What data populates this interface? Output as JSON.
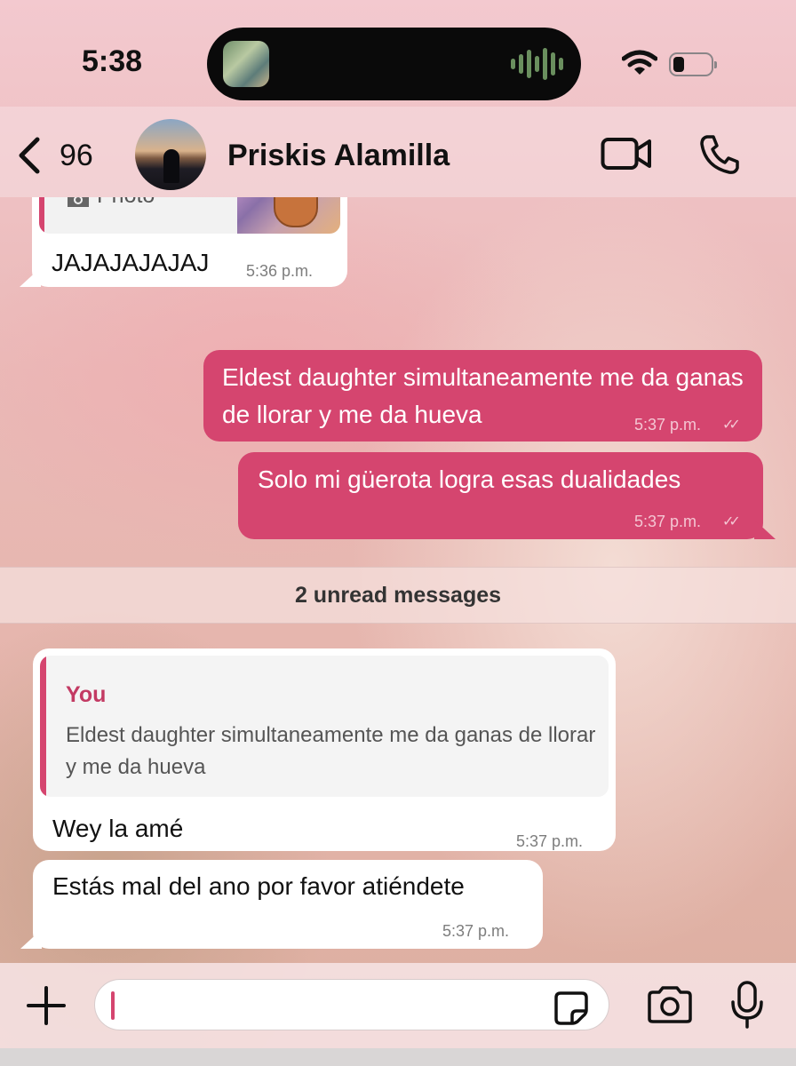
{
  "status_bar": {
    "time": "5:38"
  },
  "header": {
    "back_count": "96",
    "contact_name": "Priskis Alamilla"
  },
  "messages": [
    {
      "direction": "incoming",
      "reply_to": {
        "label": "Photo"
      },
      "text": "JAJAJAJAJAJ",
      "time": "5:36 p.m."
    },
    {
      "direction": "outgoing",
      "text": "Eldest daughter simultaneamente me da ganas de llorar y me da hueva",
      "time": "5:37 p.m."
    },
    {
      "direction": "outgoing",
      "text": "Solo mi güerota logra esas dualidades",
      "time": "5:37 p.m."
    },
    {
      "direction": "incoming",
      "reply_to": {
        "author": "You",
        "text": "Eldest daughter simultaneamente me da ganas de llorar y me da hueva"
      },
      "text": "Wey la amé",
      "time": "5:37 p.m."
    },
    {
      "direction": "incoming",
      "text": "Estás mal del ano por favor atiéndete",
      "time": "5:37 p.m."
    }
  ],
  "unread_divider": "2 unread messages",
  "composer": {
    "value": ""
  },
  "icons": {
    "back": "chevron-left-icon",
    "video": "video-camera-icon",
    "phone": "phone-icon",
    "plus": "plus-icon",
    "sticker": "sticker-icon",
    "camera": "camera-icon",
    "mic": "microphone-icon"
  },
  "colors": {
    "outgoing_bubble": "#d5456f",
    "incoming_bubble": "#ffffff",
    "accent": "#d5456f"
  }
}
